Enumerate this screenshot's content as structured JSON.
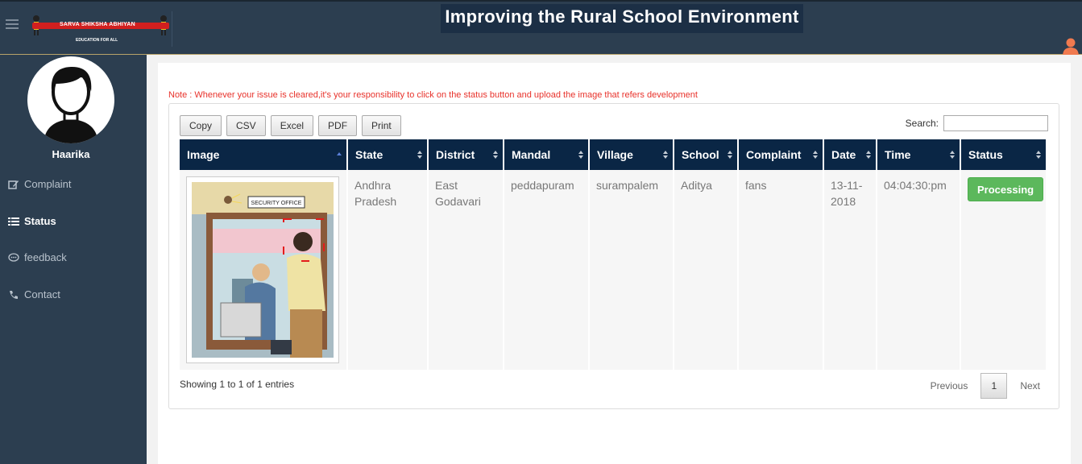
{
  "header": {
    "title": "Improving the Rural School Environment",
    "logo_text": "SARVA SHIKSHA ABHIYAN",
    "logo_subtext": "EDUCATION FOR ALL"
  },
  "sidebar": {
    "username": "Haarika",
    "items": [
      {
        "label": "Complaint",
        "icon": "edit-icon"
      },
      {
        "label": "Status",
        "icon": "list-icon"
      },
      {
        "label": "feedback",
        "icon": "comment-icon"
      },
      {
        "label": "Contact",
        "icon": "phone-icon"
      }
    ]
  },
  "main": {
    "note": "Note : Whenever your issue is cleared,it's your responsibility to click on the status button and upload the image that refers development",
    "export_buttons": [
      "Copy",
      "CSV",
      "Excel",
      "PDF",
      "Print"
    ],
    "search_label": "Search:",
    "search_value": "",
    "columns": [
      "Image",
      "State",
      "District",
      "Mandal",
      "Village",
      "School",
      "Complaint",
      "Date",
      "Time",
      "Status"
    ],
    "rows": [
      {
        "image_label": "SECURITY OFFICE",
        "state": "Andhra Pradesh",
        "district": "East Godavari",
        "mandal": "peddapuram",
        "village": "surampalem",
        "school": "Aditya",
        "complaint": "fans",
        "date": "13-11-2018",
        "time": "04:04:30:pm",
        "status": "Processing"
      }
    ],
    "entries_info": "Showing 1 to 1 of 1 entries",
    "pagination": {
      "previous": "Previous",
      "page": "1",
      "next": "Next"
    }
  },
  "colors": {
    "header_bg": "#2c3e50",
    "table_header": "#0a2645",
    "note_red": "#e8322b",
    "status_green": "#5cb85c"
  }
}
